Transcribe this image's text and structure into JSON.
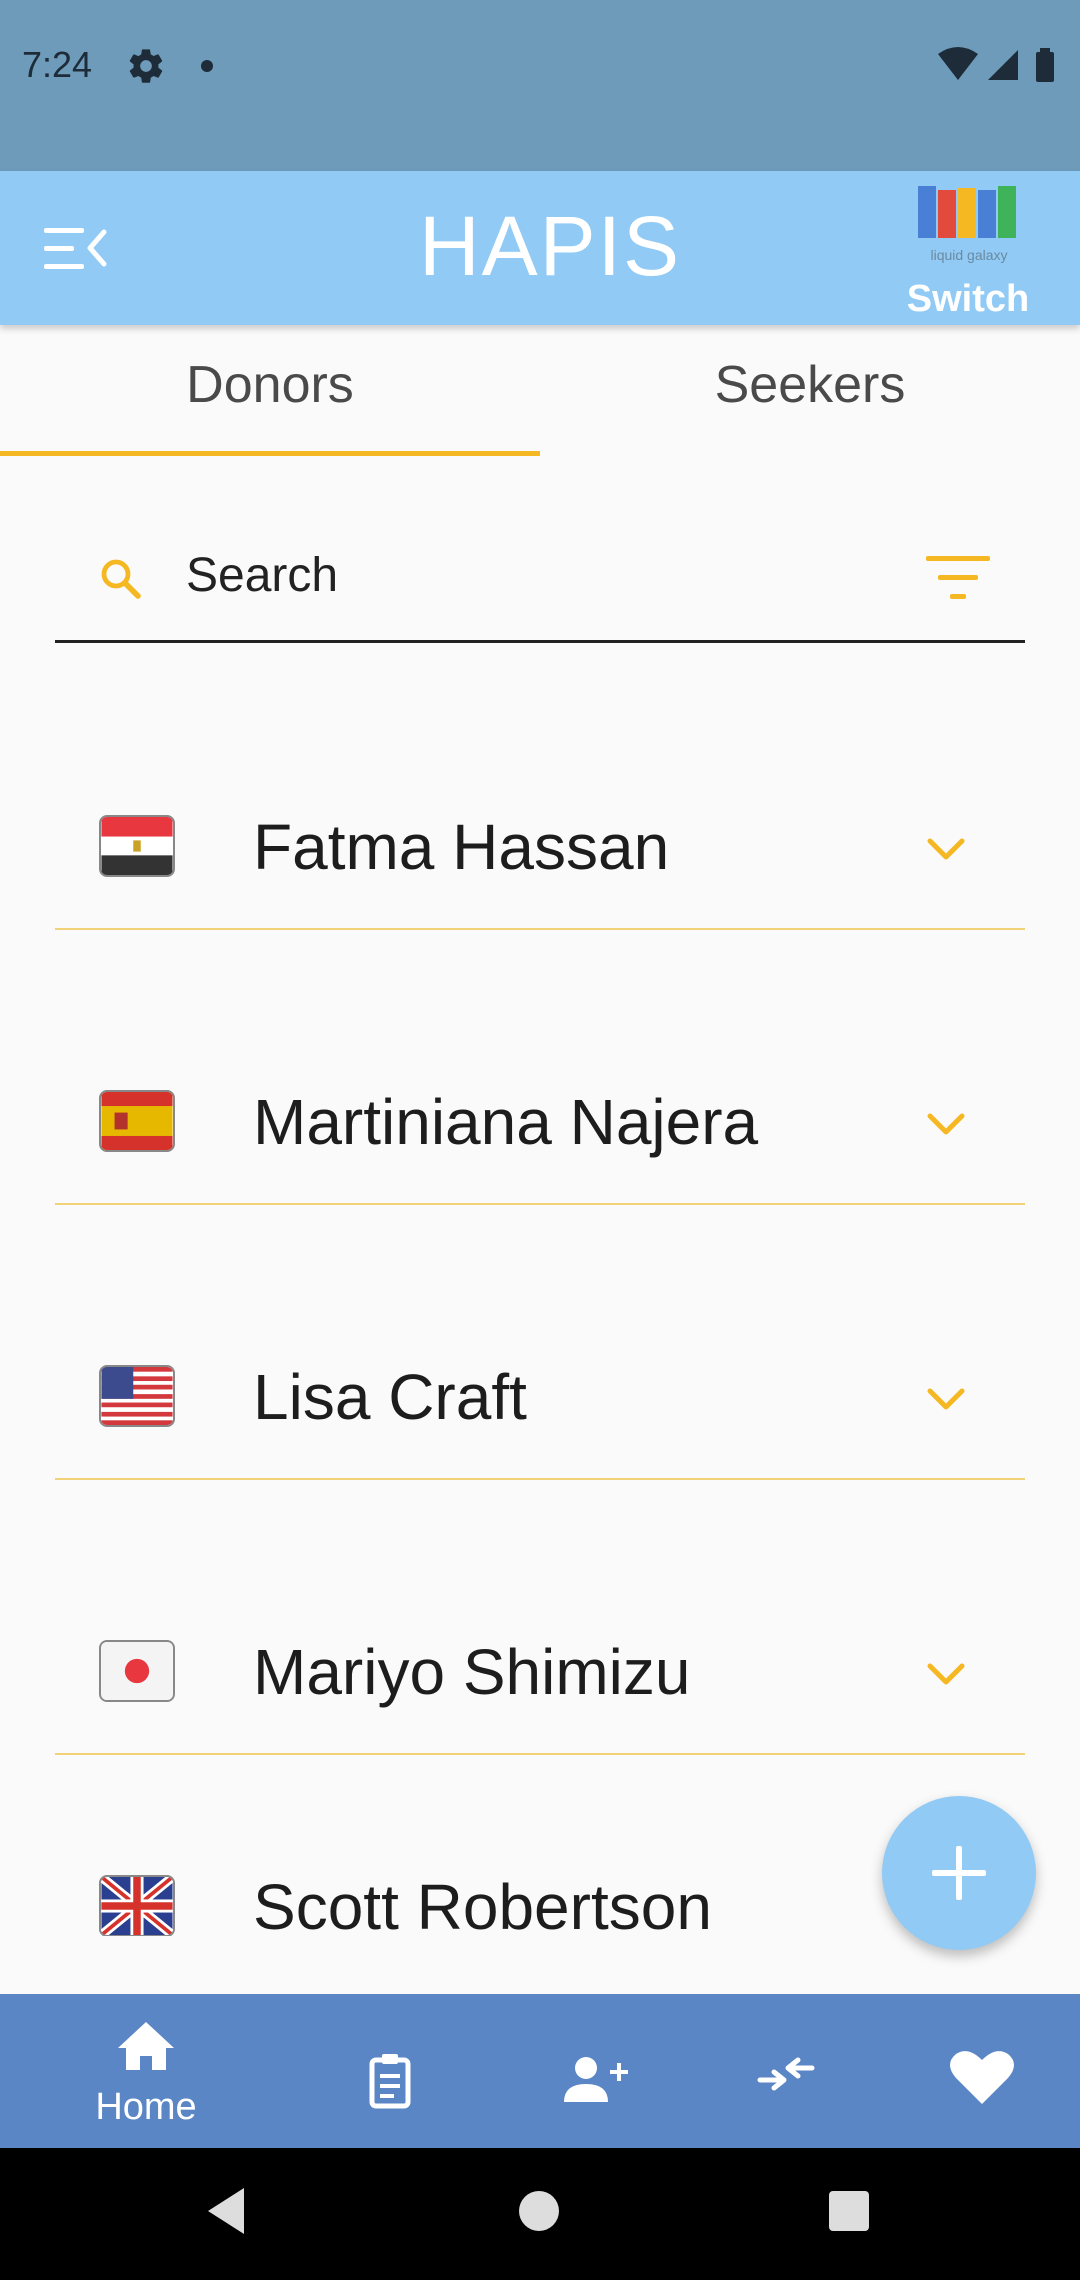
{
  "status_bar": {
    "time": "7:24"
  },
  "app_bar": {
    "title": "HAPIS",
    "switch_label": "Switch",
    "logo_text": "liquid galaxy"
  },
  "tabs": [
    {
      "label": "Donors",
      "selected": true
    },
    {
      "label": "Seekers",
      "selected": false
    }
  ],
  "search": {
    "placeholder": "Search"
  },
  "donors": [
    {
      "name": "Fatma Hassan",
      "flag": "egypt-flag"
    },
    {
      "name": "Martiniana Najera",
      "flag": "spain-flag"
    },
    {
      "name": "Lisa Craft",
      "flag": "usa-flag"
    },
    {
      "name": "Mariyo Shimizu",
      "flag": "japan-flag"
    },
    {
      "name": "Scott Robertson",
      "flag": "uk-flag"
    }
  ],
  "bottom_nav": {
    "items": [
      {
        "icon": "home-icon",
        "label": "Home",
        "selected": true
      },
      {
        "icon": "clipboard-icon"
      },
      {
        "icon": "add-person-icon"
      },
      {
        "icon": "compare-arrows-icon"
      },
      {
        "icon": "heart-icon"
      }
    ]
  },
  "colors": {
    "accent": "#f5b823",
    "app_bar": "#90caf5",
    "bottom_nav": "#5b86c5",
    "status_bar": "#6e9bba"
  }
}
